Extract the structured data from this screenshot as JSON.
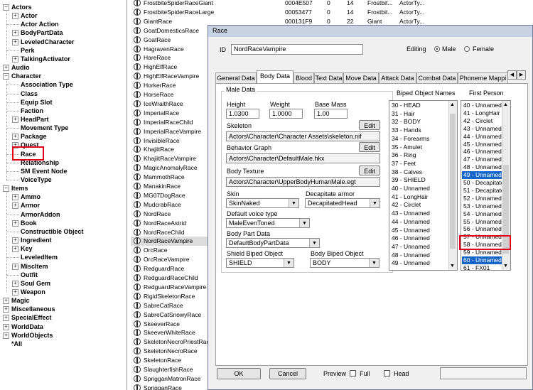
{
  "tree": [
    {
      "label": "Actors",
      "level": 0,
      "expander": "-"
    },
    {
      "label": "Actor",
      "level": 1,
      "expander": "+"
    },
    {
      "label": "Actor Action",
      "level": 1,
      "expander": ""
    },
    {
      "label": "BodyPartData",
      "level": 1,
      "expander": "+"
    },
    {
      "label": "LeveledCharacter",
      "level": 1,
      "expander": "+"
    },
    {
      "label": "Perk",
      "level": 1,
      "expander": ""
    },
    {
      "label": "TalkingActivator",
      "level": 1,
      "expander": "+"
    },
    {
      "label": "Audio",
      "level": 0,
      "expander": "+"
    },
    {
      "label": "Character",
      "level": 0,
      "expander": "-"
    },
    {
      "label": "Association Type",
      "level": 1,
      "expander": ""
    },
    {
      "label": "Class",
      "level": 1,
      "expander": ""
    },
    {
      "label": "Equip Slot",
      "level": 1,
      "expander": ""
    },
    {
      "label": "Faction",
      "level": 1,
      "expander": ""
    },
    {
      "label": "HeadPart",
      "level": 1,
      "expander": "+"
    },
    {
      "label": "Movement Type",
      "level": 1,
      "expander": ""
    },
    {
      "label": "Package",
      "level": 1,
      "expander": "+"
    },
    {
      "label": "Quest",
      "level": 1,
      "expander": "+"
    },
    {
      "label": "Race",
      "level": 1,
      "expander": "",
      "highlight": true
    },
    {
      "label": "Relationship",
      "level": 1,
      "expander": ""
    },
    {
      "label": "SM Event Node",
      "level": 1,
      "expander": ""
    },
    {
      "label": "VoiceType",
      "level": 1,
      "expander": ""
    },
    {
      "label": "Items",
      "level": 0,
      "expander": "-"
    },
    {
      "label": "Ammo",
      "level": 1,
      "expander": "+"
    },
    {
      "label": "Armor",
      "level": 1,
      "expander": "+"
    },
    {
      "label": "ArmorAddon",
      "level": 1,
      "expander": ""
    },
    {
      "label": "Book",
      "level": 1,
      "expander": "+"
    },
    {
      "label": "Constructible Object",
      "level": 1,
      "expander": ""
    },
    {
      "label": "Ingredient",
      "level": 1,
      "expander": "+"
    },
    {
      "label": "Key",
      "level": 1,
      "expander": "+"
    },
    {
      "label": "LeveledItem",
      "level": 1,
      "expander": ""
    },
    {
      "label": "MiscItem",
      "level": 1,
      "expander": "+"
    },
    {
      "label": "Outfit",
      "level": 1,
      "expander": ""
    },
    {
      "label": "Soul Gem",
      "level": 1,
      "expander": "+"
    },
    {
      "label": "Weapon",
      "level": 1,
      "expander": "+"
    },
    {
      "label": "Magic",
      "level": 0,
      "expander": "+"
    },
    {
      "label": "Miscellaneous",
      "level": 0,
      "expander": "+"
    },
    {
      "label": "SpecialEffect",
      "level": 0,
      "expander": "+"
    },
    {
      "label": "WorldData",
      "level": 0,
      "expander": "+"
    },
    {
      "label": "WorldObjects",
      "level": 0,
      "expander": "+"
    },
    {
      "label": "*All",
      "level": 0,
      "expander": ""
    }
  ],
  "list_rows": [
    {
      "name": "FrostbiteSpiderRaceGiant",
      "formid": "0004E507",
      "c1": "0",
      "c2": "14",
      "c3": "Frostbit...",
      "c4": "ActorTy..."
    },
    {
      "name": "FrostbiteSpiderRaceLarge",
      "formid": "00053477",
      "c1": "0",
      "c2": "14",
      "c3": "Frostbit...",
      "c4": "ActorTy..."
    },
    {
      "name": "GiantRace",
      "formid": "000131F9",
      "c1": "0",
      "c2": "22",
      "c3": "Giant",
      "c4": "ActorTy..."
    },
    {
      "name": "GoatDomesticsRace"
    },
    {
      "name": "GoatRace"
    },
    {
      "name": "HagravenRace"
    },
    {
      "name": "HareRace"
    },
    {
      "name": "HighElfRace"
    },
    {
      "name": "HighElfRaceVampire"
    },
    {
      "name": "HorkerRace"
    },
    {
      "name": "HorseRace"
    },
    {
      "name": "IceWraithRace"
    },
    {
      "name": "ImperialRace"
    },
    {
      "name": "ImperialRaceChild"
    },
    {
      "name": "ImperialRaceVampire"
    },
    {
      "name": "InvisibleRace"
    },
    {
      "name": "KhajiitRace"
    },
    {
      "name": "KhajiitRaceVampire"
    },
    {
      "name": "MagicAnomalyRace"
    },
    {
      "name": "MammothRace"
    },
    {
      "name": "ManakinRace"
    },
    {
      "name": "MG07DogRace"
    },
    {
      "name": "MudcrabRace"
    },
    {
      "name": "NordRace"
    },
    {
      "name": "NordRaceAstrid"
    },
    {
      "name": "NordRaceChild"
    },
    {
      "name": "NordRaceVampire",
      "selected": true
    },
    {
      "name": "OrcRace"
    },
    {
      "name": "OrcRaceVampire"
    },
    {
      "name": "RedguardRace"
    },
    {
      "name": "RedguardRaceChild"
    },
    {
      "name": "RedguardRaceVampire"
    },
    {
      "name": "RigidSkeletonRace"
    },
    {
      "name": "SabreCatRace"
    },
    {
      "name": "SabreCatSnowyRace"
    },
    {
      "name": "SkeeverRace"
    },
    {
      "name": "SkeeverWhiteRace"
    },
    {
      "name": "SkeletonNecroPriestRace"
    },
    {
      "name": "SkeletonNecroRace"
    },
    {
      "name": "SkeletonRace"
    },
    {
      "name": "SlaughterfishRace"
    },
    {
      "name": "SprigganMatronRace"
    },
    {
      "name": "SprigganRace"
    }
  ],
  "dialog": {
    "title": "Race",
    "id_label": "ID",
    "id_value": "NordRaceVampire",
    "editing_label": "Editing",
    "male_label": "Male",
    "female_label": "Female",
    "tabs": [
      "General Data",
      "Body Data",
      "Blood",
      "Text Data",
      "Move Data",
      "Attack Data",
      "Combat Data",
      "Phoneme Mappi"
    ],
    "active_tab": 1,
    "male_data_label": "Male Data",
    "height_label": "Height",
    "height_value": "1.0300",
    "weight_label": "Weight",
    "weight_value": "1.0000",
    "basemass_label": "Base Mass",
    "basemass_value": "1.00",
    "skeleton_label": "Skeleton",
    "skeleton_value": "Actors\\Character\\Character Assets\\skeleton.nif",
    "behavior_label": "Behavior Graph",
    "behavior_value": "Actors\\Character\\DefaultMale.hkx",
    "bodytex_label": "Body Texture",
    "bodytex_value": "Actors\\Character\\UpperBodyHumanMale.egt",
    "edit_label": "Edit",
    "skin_label": "Skin",
    "skin_value": "SkinNaked",
    "decap_label": "Decapitate armor",
    "decap_value": "DecapitatedHead",
    "voice_label": "Default voice type",
    "voice_value": "MaleEvenToned",
    "bodypart_label": "Body Part Data",
    "bodypart_value": "DefaultBodyPartData",
    "shield_label": "Shield Biped Object",
    "shield_value": "SHIELD",
    "bodybiped_label": "Body Biped Object",
    "bodybiped_value": "BODY",
    "biped_names_label": "Biped Object Names",
    "biped_names": [
      "30 - HEAD",
      "31 - Hair",
      "32 - BODY",
      "33 - Hands",
      "34 - Forearms",
      "35 - Amulet",
      "36 - Ring",
      "37 - Feet",
      "38 - Calves",
      "39 - SHIELD",
      "40 - Unnamed",
      "41 - LongHair",
      "42 - Circlet",
      "43 - Unnamed",
      "44 - Unnamed",
      "45 - Unnamed",
      "46 - Unnamed",
      "47 - Unnamed",
      "48 - Unnamed",
      "49 - Unnamed"
    ],
    "first_person_label": "First Person",
    "first_person": [
      {
        "t": "40 - Unnamed"
      },
      {
        "t": "41 - LongHair"
      },
      {
        "t": "42 - Circlet"
      },
      {
        "t": "43 - Unnamed"
      },
      {
        "t": "44 - Unnamed"
      },
      {
        "t": "45 - Unnamed"
      },
      {
        "t": "46 - Unnamed"
      },
      {
        "t": "47 - Unnamed"
      },
      {
        "t": "48 - Unnamed"
      },
      {
        "t": "49 - Unnamed",
        "sel": true
      },
      {
        "t": "50 - DecapitateH"
      },
      {
        "t": "51 - Decapitate"
      },
      {
        "t": "52 - Unnamed"
      },
      {
        "t": "53 - Unnamed"
      },
      {
        "t": "54 - Unnamed"
      },
      {
        "t": "55 - Unnamed"
      },
      {
        "t": "56 - Unnamed"
      },
      {
        "t": "57 - Unnamed"
      },
      {
        "t": "58 - Unnamed"
      },
      {
        "t": "59 - Unnamed"
      },
      {
        "t": "60 - Unnamed",
        "sel": true
      },
      {
        "t": "61 - FX01"
      }
    ],
    "ok_label": "OK",
    "cancel_label": "Cancel",
    "preview_label": "Preview",
    "full_label": "Full",
    "head_label": "Head"
  },
  "colors": {
    "highlight_box": "#e0001b",
    "selection": "#1565c8"
  }
}
